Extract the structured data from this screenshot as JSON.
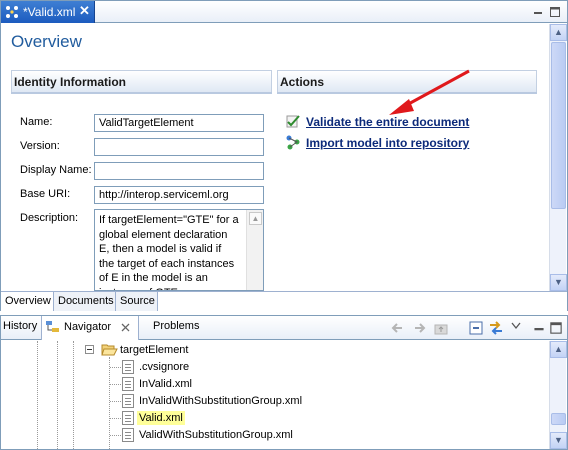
{
  "editor": {
    "tab_title": "*Valid.xml",
    "close_glyph": "✕",
    "overview_title": "Overview",
    "identity": {
      "heading": "Identity Information",
      "name_label": "Name:",
      "name_value": "ValidTargetElement",
      "version_label": "Version:",
      "version_value": "",
      "display_name_label": "Display Name:",
      "display_name_value": "",
      "base_uri_label": "Base URI:",
      "base_uri_value": "http://interop.serviceml.org",
      "description_label": "Description:",
      "description_value": "If targetElement=\"GTE\" for a global element declaration E, then a model is valid if the target of each instances of E in the model is an instance of GTE."
    },
    "actions": {
      "heading": "Actions",
      "validate_label": "Validate the entire document",
      "import_label": "Import model into repository"
    },
    "bottom_tabs": [
      "Overview",
      "Documents",
      "Source"
    ]
  },
  "navigator": {
    "tabs": {
      "history": "History",
      "navigator": "Navigator",
      "problems": "Problems"
    },
    "folder": "targetElement",
    "files": [
      ".cvsignore",
      "InValid.xml",
      "InValidWithSubstitutionGroup.xml",
      "Valid.xml",
      "ValidWithSubstitutionGroup.xml"
    ],
    "selected_file": "Valid.xml"
  },
  "colors": {
    "title_blue": "#215c9e",
    "link_navy": "#0c2a7a",
    "arrow_red": "#e0191c",
    "selection_yellow": "#ffff99",
    "active_tab_blue": "#2a6acb"
  },
  "icons": {
    "editor_tab": "xml-model-icon",
    "validate": "validate-check-icon",
    "import": "import-model-icon",
    "folder": "open-folder-icon",
    "file": "file-icon",
    "navigator_tab": "navigator-icon"
  }
}
